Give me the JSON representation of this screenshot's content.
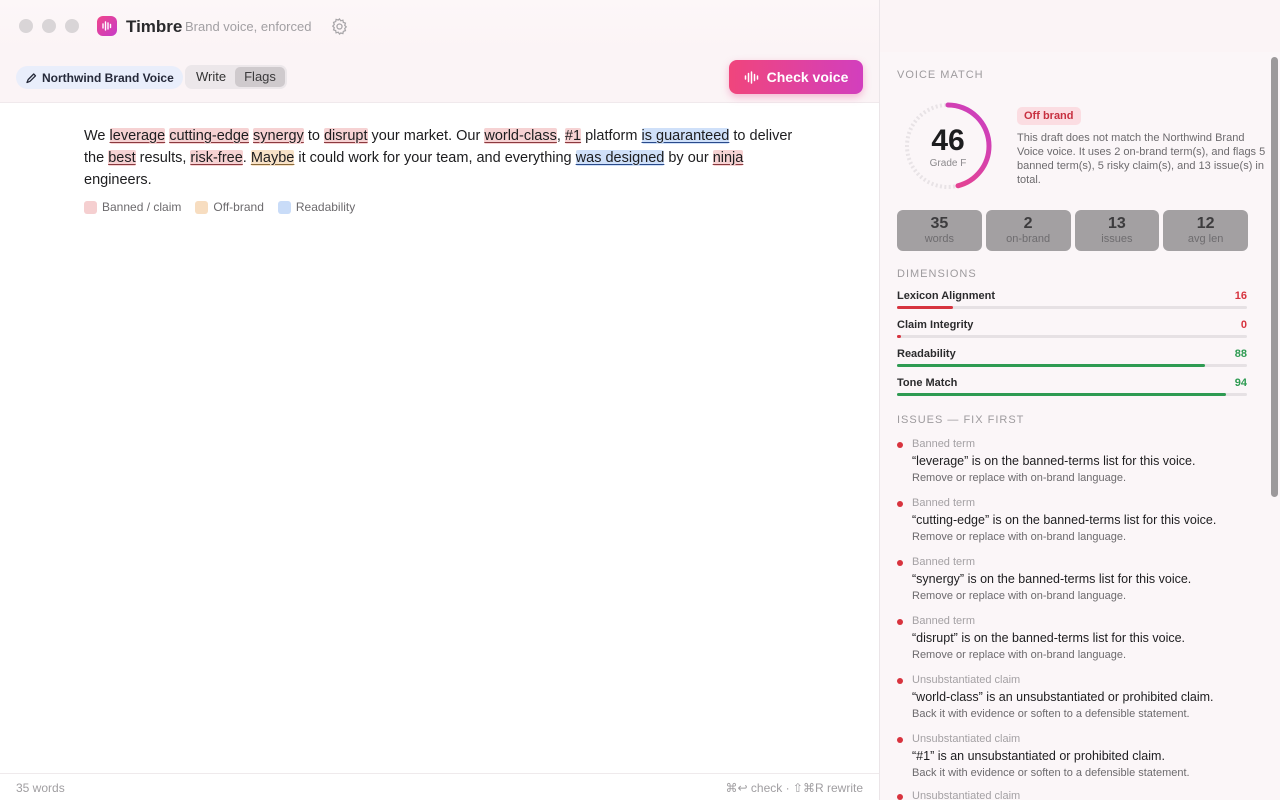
{
  "app": {
    "title": "Timbre",
    "subtitle": "Brand voice, enforced"
  },
  "toolbar": {
    "voice_label": "Northwind Brand Voice",
    "tabs": [
      {
        "label": "Write",
        "active": false
      },
      {
        "label": "Flags",
        "active": true
      }
    ],
    "check_label": "Check voice"
  },
  "document": {
    "segments": [
      {
        "t": "We ",
        "k": ""
      },
      {
        "t": "leverage",
        "k": "red"
      },
      {
        "t": " ",
        "k": ""
      },
      {
        "t": "cutting-edge",
        "k": "red"
      },
      {
        "t": " ",
        "k": ""
      },
      {
        "t": "synergy",
        "k": "red"
      },
      {
        "t": " to ",
        "k": ""
      },
      {
        "t": "disrupt",
        "k": "red"
      },
      {
        "t": " your market. Our ",
        "k": ""
      },
      {
        "t": "world-class",
        "k": "red"
      },
      {
        "t": ", ",
        "k": ""
      },
      {
        "t": "#1",
        "k": "red"
      },
      {
        "t": " platform ",
        "k": ""
      },
      {
        "t": "is guaranteed",
        "k": "blue"
      },
      {
        "t": " to deliver the ",
        "k": ""
      },
      {
        "t": "best",
        "k": "red"
      },
      {
        "t": " results, ",
        "k": ""
      },
      {
        "t": "risk-free",
        "k": "red"
      },
      {
        "t": ". ",
        "k": ""
      },
      {
        "t": "Maybe",
        "k": "orange"
      },
      {
        "t": " it could work for your team, and everything ",
        "k": ""
      },
      {
        "t": "was designed",
        "k": "blue"
      },
      {
        "t": " by our ",
        "k": ""
      },
      {
        "t": "ninja",
        "k": "red"
      },
      {
        "t": " engineers.",
        "k": ""
      }
    ]
  },
  "legend": [
    {
      "label": "Banned / claim",
      "color": "#f5cfd0"
    },
    {
      "label": "Off-brand",
      "color": "#f7ddc0"
    },
    {
      "label": "Readability",
      "color": "#c9dcf8"
    }
  ],
  "status": {
    "word_count": "35 words",
    "shortcuts": "⌘↩ check · ⇧⌘R rewrite"
  },
  "panel": {
    "voice_match_heading": "VOICE MATCH",
    "score": "46",
    "score_fraction": 0.46,
    "grade": "Grade F",
    "badge": "Off brand",
    "summary": "This draft does not match the Northwind Brand Voice voice. It uses 2 on-brand term(s), and flags 5 banned term(s), 5 risky claim(s), and 13 issue(s) in total.",
    "stats": [
      {
        "num": "35",
        "label": "words"
      },
      {
        "num": "2",
        "label": "on-brand"
      },
      {
        "num": "13",
        "label": "issues"
      },
      {
        "num": "12",
        "label": "avg len"
      }
    ],
    "dimensions_heading": "DIMENSIONS",
    "dimensions": [
      {
        "name": "Lexicon Alignment",
        "value": "16",
        "fraction": 0.16,
        "color": "#d7343f"
      },
      {
        "name": "Claim Integrity",
        "value": "0",
        "fraction": 0.0,
        "color": "#d7343f"
      },
      {
        "name": "Readability",
        "value": "88",
        "fraction": 0.88,
        "color": "#2e9b52"
      },
      {
        "name": "Tone Match",
        "value": "94",
        "fraction": 0.94,
        "color": "#2e9b52"
      }
    ],
    "issues_heading": "ISSUES — FIX FIRST",
    "issues": [
      {
        "type": "Banned term",
        "title": "“leverage” is on the banned-terms list for this voice.",
        "hint": "Remove or replace with on-brand language."
      },
      {
        "type": "Banned term",
        "title": "“cutting-edge” is on the banned-terms list for this voice.",
        "hint": "Remove or replace with on-brand language."
      },
      {
        "type": "Banned term",
        "title": "“synergy” is on the banned-terms list for this voice.",
        "hint": "Remove or replace with on-brand language."
      },
      {
        "type": "Banned term",
        "title": "“disrupt” is on the banned-terms list for this voice.",
        "hint": "Remove or replace with on-brand language."
      },
      {
        "type": "Unsubstantiated claim",
        "title": "“world-class” is an unsubstantiated or prohibited claim.",
        "hint": "Back it with evidence or soften to a defensible statement."
      },
      {
        "type": "Unsubstantiated claim",
        "title": "“#1” is an unsubstantiated or prohibited claim.",
        "hint": "Back it with evidence or soften to a defensible statement."
      },
      {
        "type": "Unsubstantiated claim",
        "title": "",
        "hint": ""
      }
    ]
  }
}
